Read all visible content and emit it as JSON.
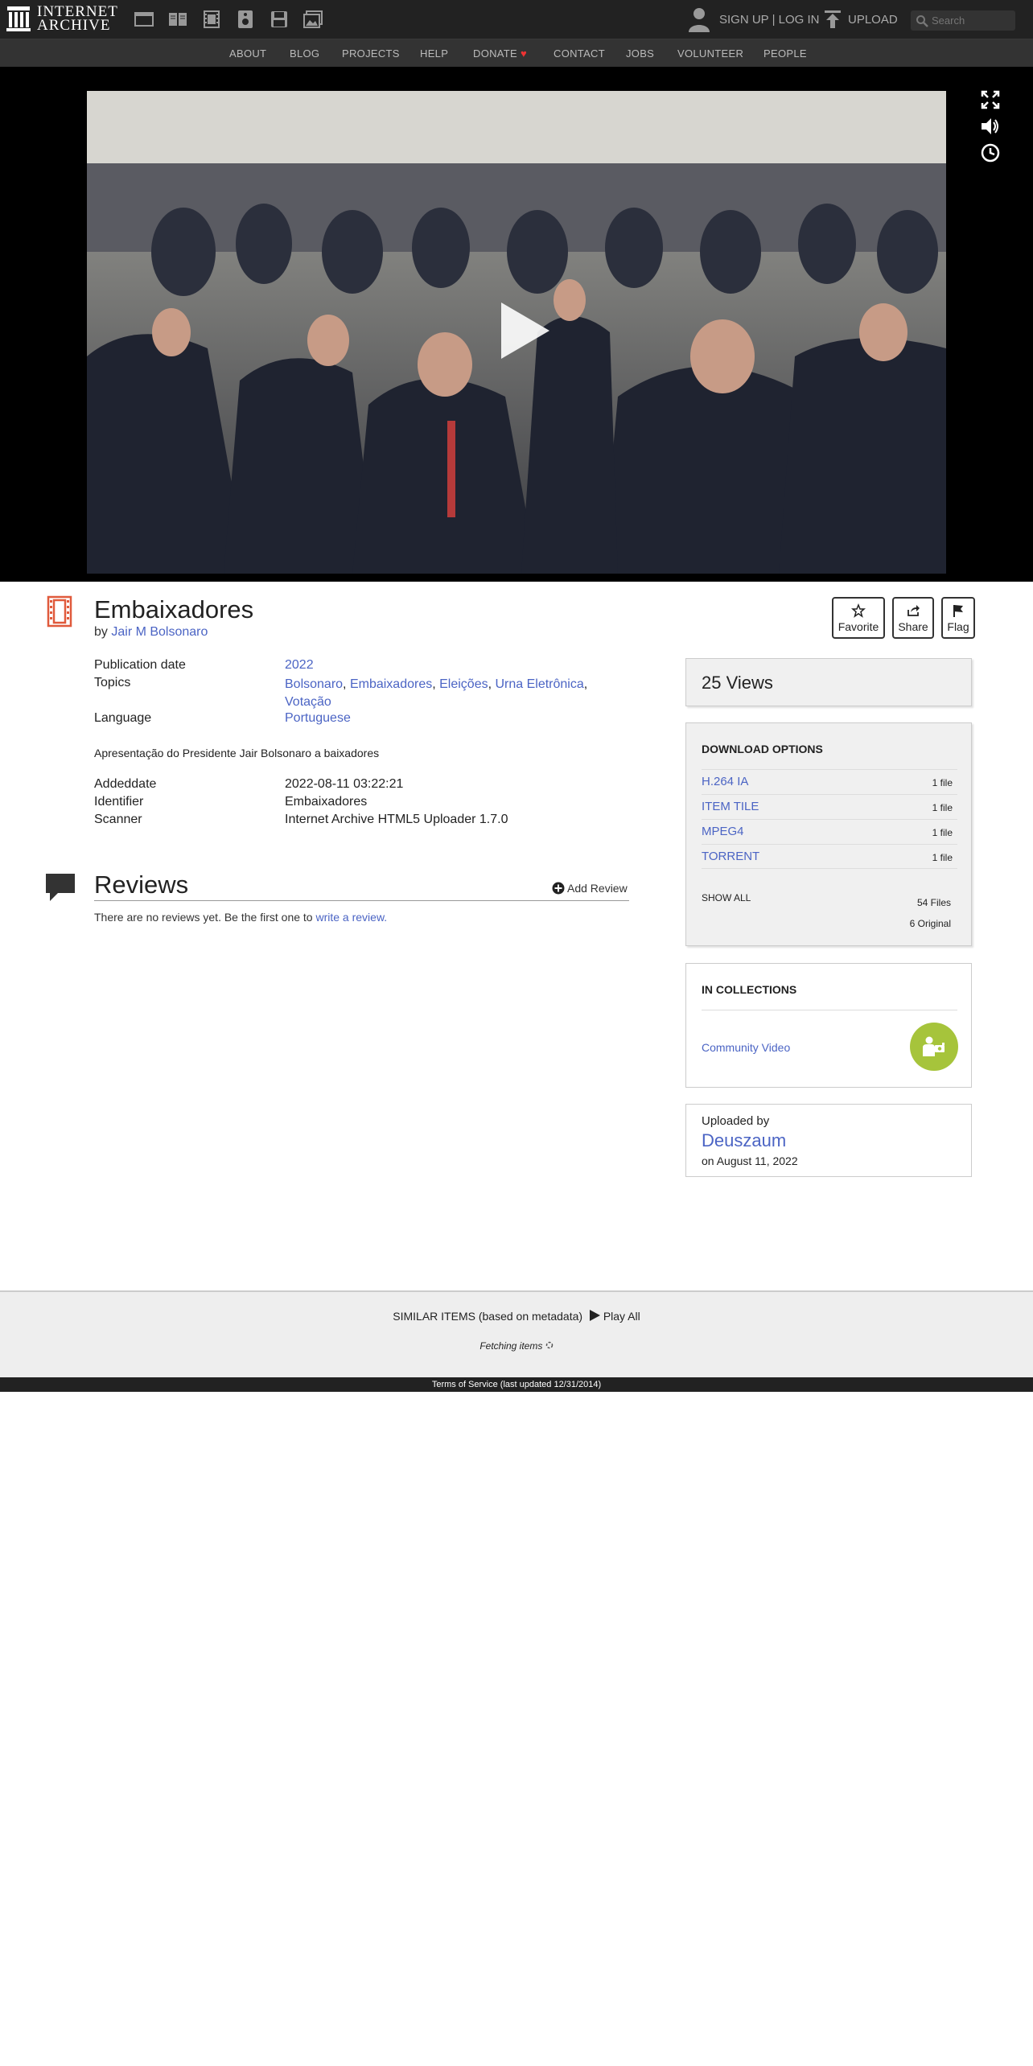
{
  "header": {
    "logo_line1": "INTERNET",
    "logo_line2": "ARCHIVE",
    "media_icons": [
      "web-icon",
      "texts-icon",
      "video-icon",
      "audio-icon",
      "software-icon",
      "images-icon"
    ],
    "signup_login": "SIGN UP | LOG IN",
    "upload": "UPLOAD",
    "search_placeholder": "Search"
  },
  "nav": {
    "items": [
      "ABOUT",
      "BLOG",
      "PROJECTS",
      "HELP",
      "DONATE",
      "CONTACT",
      "JOBS",
      "VOLUNTEER",
      "PEOPLE"
    ]
  },
  "video": {
    "controls": [
      "fullscreen-icon",
      "volume-icon",
      "clock-icon"
    ]
  },
  "item": {
    "title": "Embaixadores",
    "by_prefix": "by",
    "creator": "Jair M Bolsonaro",
    "actions": [
      "Favorite",
      "Share",
      "Flag"
    ]
  },
  "metadata": {
    "publication_date_label": "Publication date",
    "publication_date": "2022",
    "topics_label": "Topics",
    "topics": [
      "Bolsonaro",
      "Embaixadores",
      "Eleições",
      "Urna Eletrônica",
      "Votação"
    ],
    "language_label": "Language",
    "language": "Portuguese",
    "description": "Apresentação do Presidente Jair Bolsonaro a baixadores",
    "addeddate_label": "Addeddate",
    "addeddate": "2022-08-11 03:22:21",
    "identifier_label": "Identifier",
    "identifier": "Embaixadores",
    "scanner_label": "Scanner",
    "scanner": "Internet Archive HTML5 Uploader 1.7.0"
  },
  "reviews": {
    "title": "Reviews",
    "add_review": "Add Review",
    "empty_text": "There are no reviews yet. Be the first one to",
    "write_link": "write a review."
  },
  "sidebar": {
    "views": "25 Views",
    "downloads": {
      "title": "DOWNLOAD OPTIONS",
      "rows": [
        {
          "format": "H.264 IA",
          "count": "1 file"
        },
        {
          "format": "ITEM TILE",
          "count": "1 file"
        },
        {
          "format": "MPEG4",
          "count": "1 file"
        },
        {
          "format": "TORRENT",
          "count": "1 file"
        }
      ],
      "show_all": "SHOW ALL",
      "files": "54 Files",
      "original": "6 Original"
    },
    "collections": {
      "title": "IN COLLECTIONS",
      "name": "Community Video",
      "badge_color": "#a6c43b"
    },
    "uploader": {
      "label": "Uploaded by",
      "name": "Deuszaum",
      "date": "on August 11, 2022"
    }
  },
  "similar": {
    "heading": "SIMILAR ITEMS (based on metadata)",
    "play_all": "Play All",
    "fetching": "Fetching items"
  },
  "footer": {
    "terms": "Terms of Service (last updated 12/31/2014)"
  },
  "colors": {
    "link": "#4b64c4",
    "topbar": "#222222",
    "donate_heart": "#ee3333",
    "film_icon": "#e05a3c"
  }
}
